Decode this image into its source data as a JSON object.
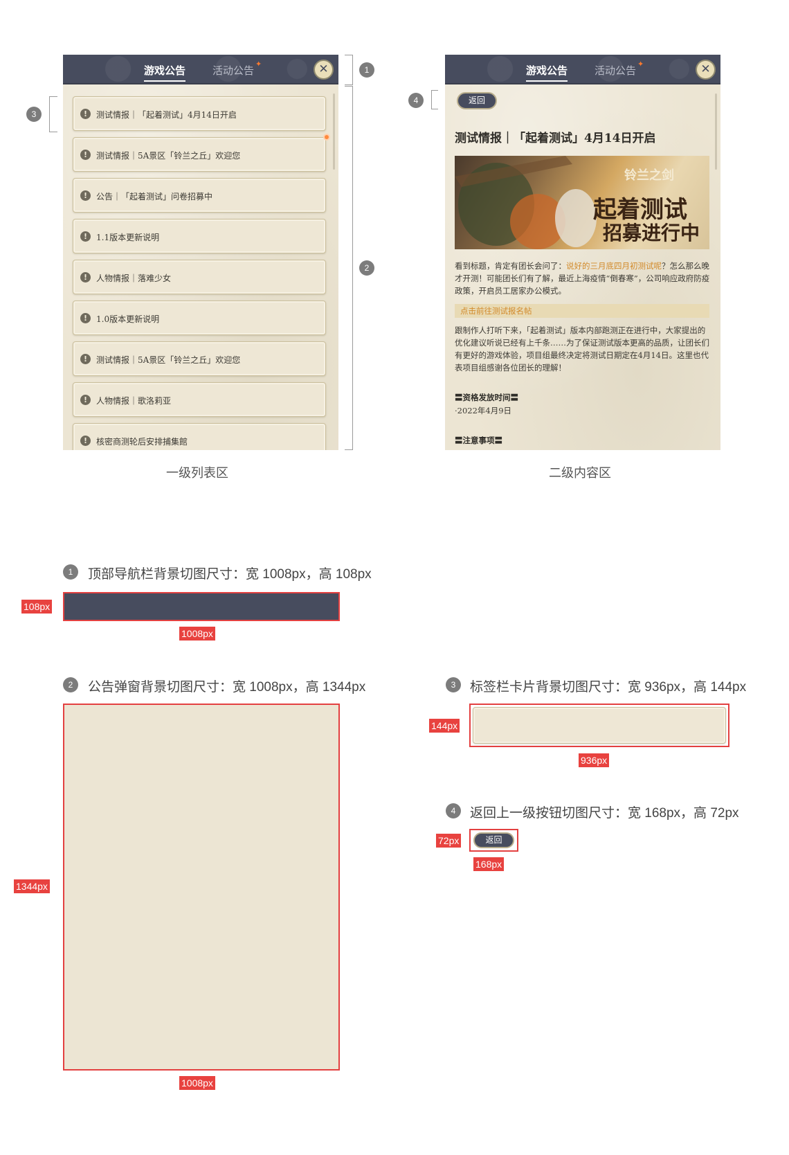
{
  "list_panel": {
    "tabs": [
      {
        "label": "游戏公告",
        "active": true
      },
      {
        "label": "活动公告",
        "active": false
      }
    ],
    "close_glyph": "✕",
    "items": [
      {
        "title": "测试情报｜「起着测试」4月14日开启"
      },
      {
        "title": "测试情报｜5A景区「铃兰之丘」欢迎您"
      },
      {
        "title": "公告｜「起着测试」问卷招募中"
      },
      {
        "title": "1.1版本更新说明"
      },
      {
        "title": "人物情报｜落难少女"
      },
      {
        "title": "1.0版本更新说明"
      },
      {
        "title": "测试情报｜5A景区「铃兰之丘」欢迎您"
      },
      {
        "title": "人物情报｜歌洛莉亚"
      },
      {
        "title": "核密商测轮后安排捕集館"
      }
    ],
    "caption": "一级列表区"
  },
  "content_panel": {
    "tabs": [
      {
        "label": "游戏公告",
        "active": true
      },
      {
        "label": "活动公告",
        "active": false
      }
    ],
    "close_glyph": "✕",
    "back_label": "返回",
    "article_title": "测试情报｜「起着测试」4月14日开启",
    "banner": {
      "logo_text": "铃兰之剑",
      "headline_1": "起着测试",
      "headline_2": "招募进行中"
    },
    "para1_before": "看到标题，肯定有团长会问了：",
    "para1_highlight": "说好的三月底四月初测试呢",
    "para1_after": "？怎么那么晚才开测！可能团长们有了解，最近上海疫情“倒春寒”，公司响应政府防疫政策，开启员工居家办公模式。",
    "link_text": "点击前往测试报名帖",
    "para2": "跟制作人打听下来，「起着测试」版本内部跑测正在进行中，大家提出的优化建议听说已经有上千条……为了保证测试版本更高的品质，让团长们有更好的游戏体验，项目组最终决定将测试日期定在4月14日。这里也代表项目组感谢各位团长的理解！",
    "section1_head": "〓资格发放时间〓",
    "section1_body": "·2022年4月9日",
    "section2_head": "〓注意事项〓",
    "caption": "二级内容区"
  },
  "annotations": {
    "markers": [
      "1",
      "2",
      "3",
      "4"
    ]
  },
  "specs": {
    "spec1": {
      "number": "1",
      "text": "顶部导航栏背景切图尺寸：宽 1008px，高 108px",
      "height_tag": "108px",
      "width_tag": "1008px"
    },
    "spec2": {
      "number": "2",
      "text": "公告弹窗背景切图尺寸：宽 1008px，高 1344px",
      "height_tag": "1344px",
      "width_tag": "1008px"
    },
    "spec3": {
      "number": "3",
      "text": "标签栏卡片背景切图尺寸：宽 936px，高 144px",
      "height_tag": "144px",
      "width_tag": "936px"
    },
    "spec4": {
      "number": "4",
      "text": "返回上一级按钮切图尺寸：宽 168px，高 72px",
      "height_tag": "72px",
      "width_tag": "168px",
      "button_label": "返回"
    }
  },
  "colors": {
    "navbar": "#474c5e",
    "paper": "#ece5d3",
    "highlight": "#d28a2a",
    "red_tag": "#e8423f"
  }
}
